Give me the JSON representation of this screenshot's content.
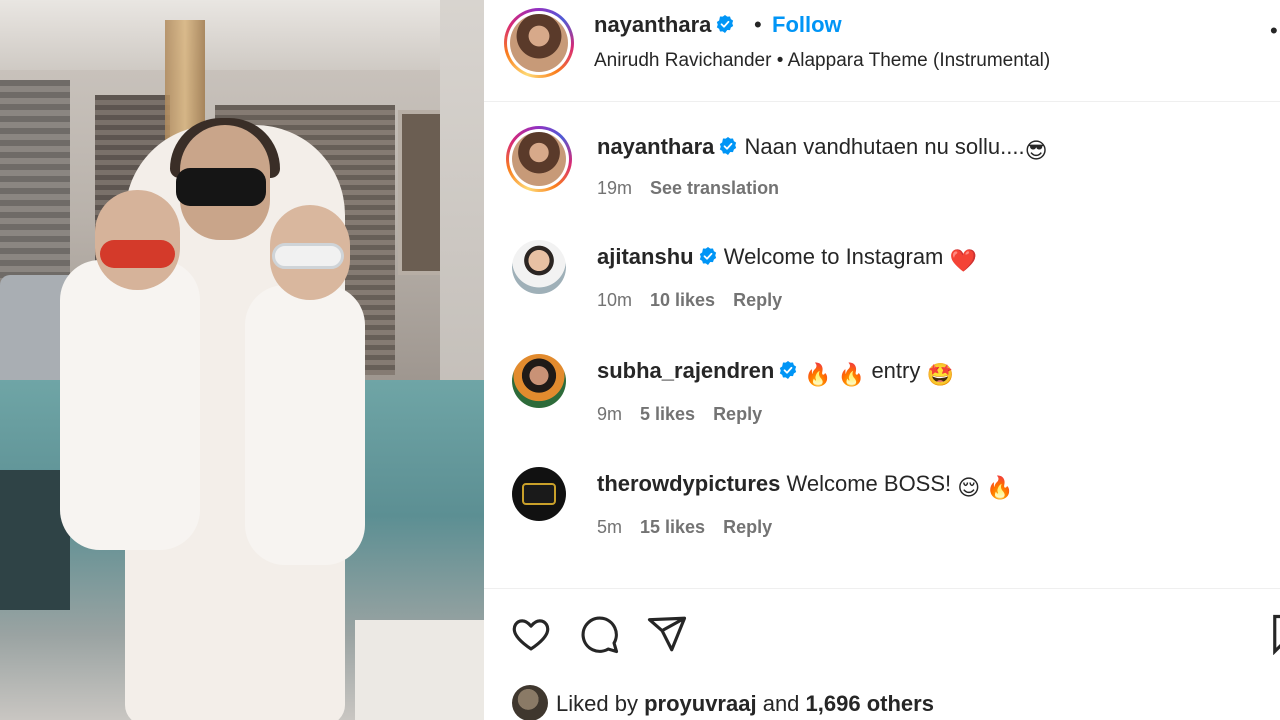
{
  "post": {
    "username": "nayanthara",
    "separator": "•",
    "follow_label": "Follow",
    "music": "Anirudh Ravichander • Alappara Theme (Instrumental)",
    "more_icon": "more-dots-icon"
  },
  "caption": {
    "username": "nayanthara",
    "text": "Naan vandhutaen nu sollu....",
    "emoji": "😎",
    "time": "19m",
    "translate_label": "See translation"
  },
  "comments": [
    {
      "username": "ajitanshu",
      "text": "Welcome to Instagram",
      "emoji": "❤️",
      "time": "10m",
      "likes": "10 likes",
      "reply": "Reply"
    },
    {
      "username": "subha_rajendren",
      "text": "entry",
      "emoji_before": "🔥 🔥",
      "emoji": "🤩",
      "time": "9m",
      "likes": "5 likes",
      "reply": "Reply"
    },
    {
      "username": "therowdypictures",
      "text": "Welcome BOSS!",
      "emoji": "😌 🔥",
      "time": "5m",
      "likes": "15 likes",
      "reply": "Reply"
    }
  ],
  "footer": {
    "liked_prefix": "Liked by",
    "liked_user": "proyuvraaj",
    "liked_and": "and",
    "liked_others": "1,696 others"
  },
  "colors": {
    "follow": "#0095f6",
    "verified": "#0095f6",
    "text": "#262626",
    "meta": "#737373"
  }
}
